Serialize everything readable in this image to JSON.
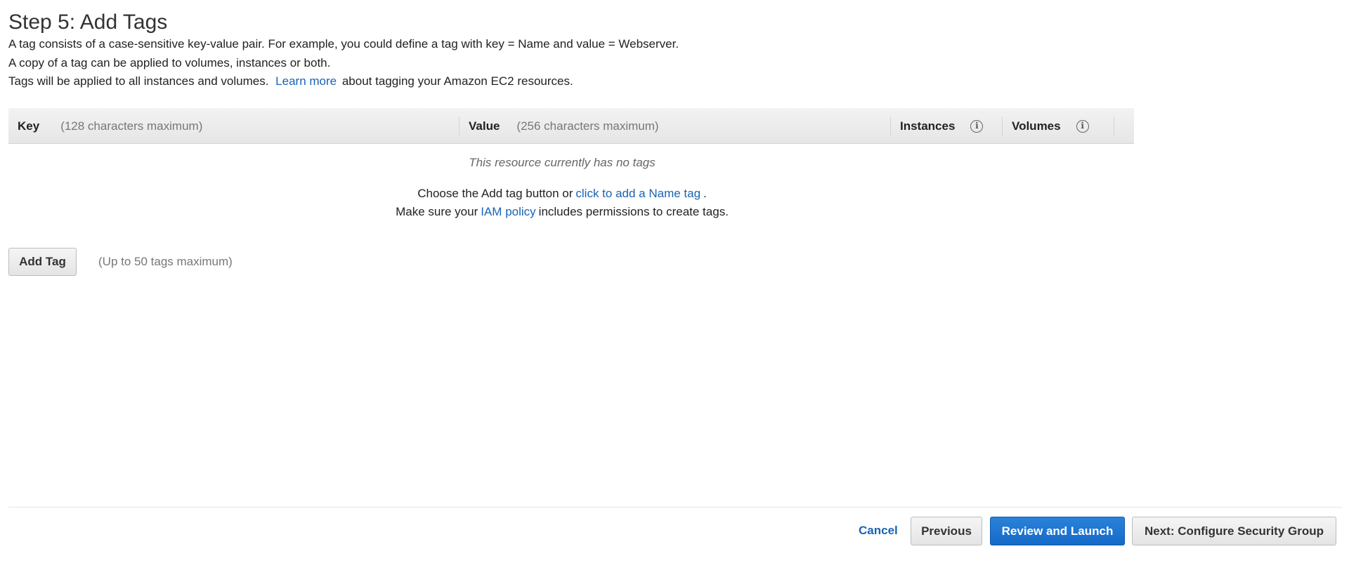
{
  "page": {
    "title": "Step 5: Add Tags"
  },
  "intro": {
    "line1": "A tag consists of a case-sensitive key-value pair. For example, you could define a tag with key = Name and value = Webserver.",
    "line2": "A copy of a tag can be applied to volumes, instances or both.",
    "line3_before": "Tags will be applied to all instances and volumes.",
    "line3_link": "Learn more",
    "line3_after": "about tagging your Amazon EC2 resources."
  },
  "table": {
    "columns": [
      {
        "label": "Key",
        "hint": "(128 characters maximum)"
      },
      {
        "label": "Value",
        "hint": "(256 characters maximum)"
      },
      {
        "label": "Instances",
        "icon": "info-icon"
      },
      {
        "label": "Volumes",
        "icon": "info-icon"
      }
    ],
    "info_icon_glyph": "i"
  },
  "empty_state": {
    "message": "This resource currently has no tags",
    "choose_before": "Choose the Add tag button or",
    "choose_link": "click to add a Name tag",
    "choose_after": ".",
    "iam_before": "Make sure your",
    "iam_link": "IAM policy",
    "iam_after": "includes permissions to create tags."
  },
  "add_tag": {
    "button_label": "Add Tag",
    "hint": "(Up to 50 tags maximum)"
  },
  "footer": {
    "cancel_label": "Cancel",
    "previous_label": "Previous",
    "review_label": "Review and Launch",
    "next_label": "Next: Configure Security Group"
  },
  "colors": {
    "link": "#1a63b3",
    "primary_button": "#1569c7",
    "header_background": "#eaeaea"
  }
}
